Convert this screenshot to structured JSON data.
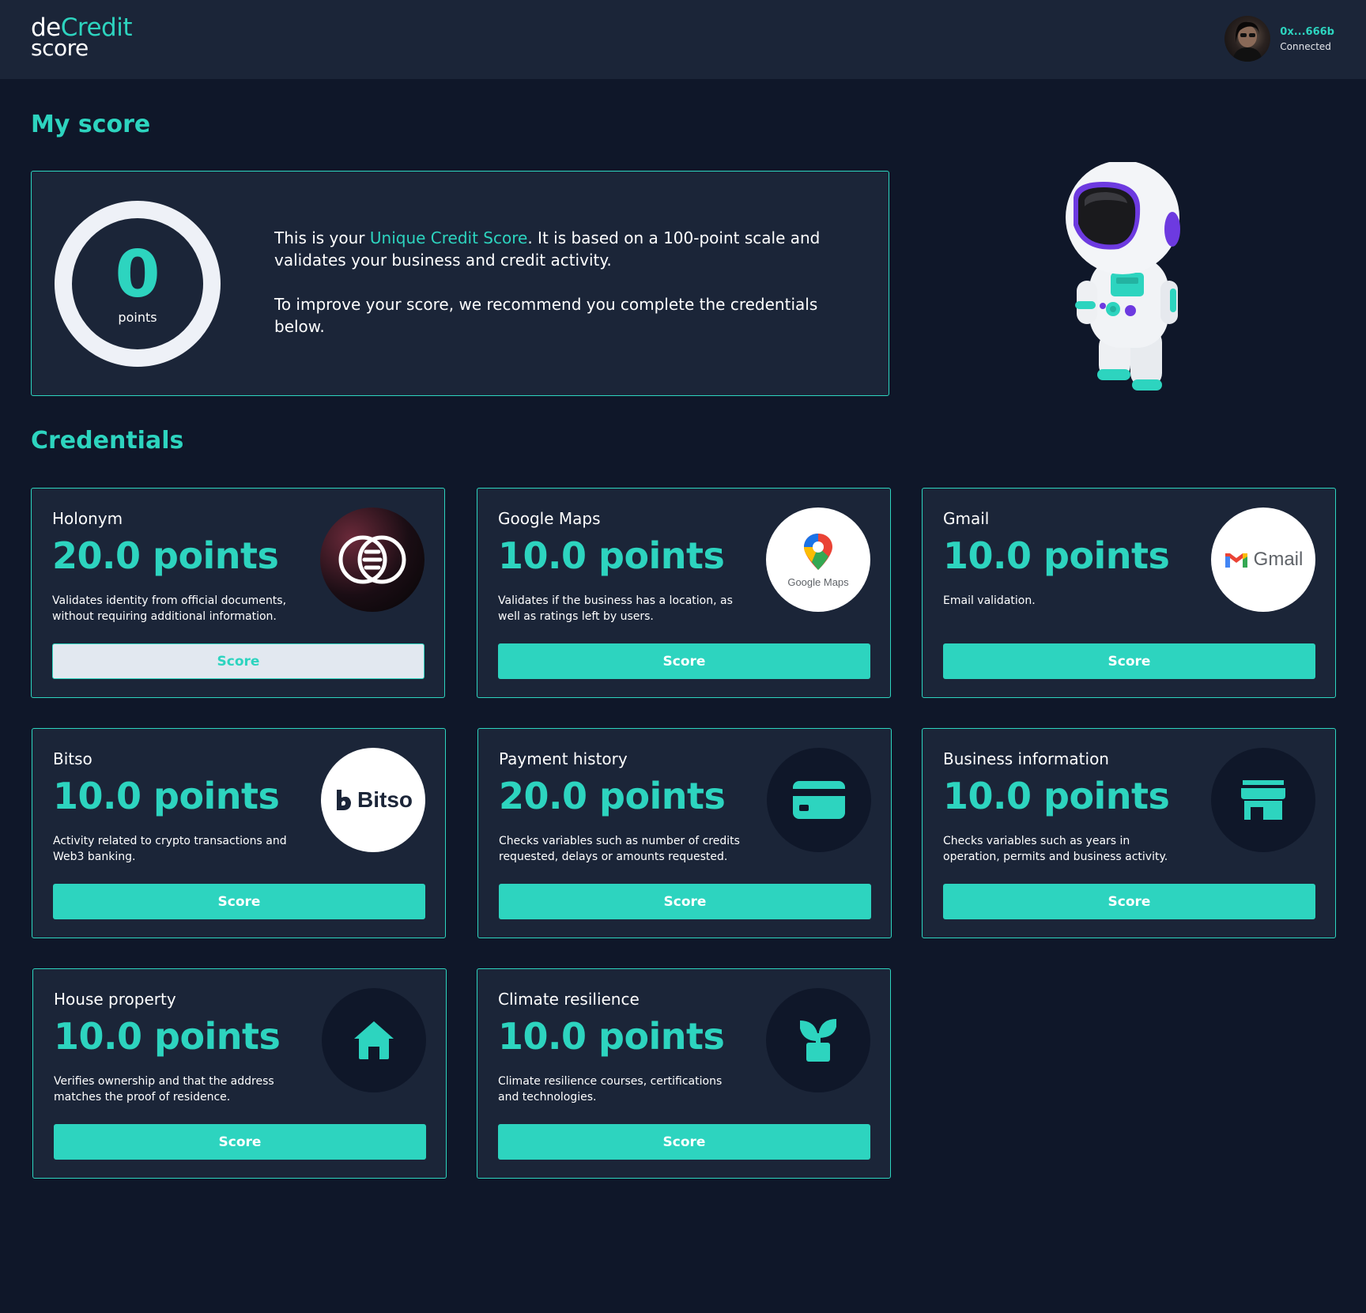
{
  "header": {
    "logo_de": "de",
    "logo_credit": "Credit",
    "logo_score": "score",
    "wallet_address": "0x...666b",
    "wallet_status": "Connected"
  },
  "my_score": {
    "title": "My score",
    "value": "0",
    "unit": "points",
    "text_prefix": "This is your ",
    "text_highlight": "Unique Credit Score",
    "text_suffix": ". It is based on a 100-point scale and validates your business and credit activity.",
    "recommendation": "To improve your score, we recommend you complete the credentials below."
  },
  "credentials": {
    "title": "Credentials",
    "items": [
      {
        "name": "Holonym",
        "points": "20.0 points",
        "description": "Validates identity from official documents, without requiring additional information.",
        "button": "Score",
        "icon": "holonym-logo",
        "button_style": "light"
      },
      {
        "name": "Google Maps",
        "points": "10.0 points",
        "description": "Validates if the business has a location, as well as ratings left by users.",
        "button": "Score",
        "icon": "google-maps-logo",
        "logo_text": "Google Maps"
      },
      {
        "name": "Gmail",
        "points": "10.0 points",
        "description": "Email validation.",
        "button": "Score",
        "icon": "gmail-logo",
        "logo_text": "Gmail"
      },
      {
        "name": "Bitso",
        "points": "10.0 points",
        "description": "Activity related to crypto transactions and Web3 banking.",
        "button": "Score",
        "icon": "bitso-logo",
        "logo_text": "Bitso"
      },
      {
        "name": "Payment history",
        "points": "20.0 points",
        "description": "Checks variables such as number of credits requested, delays or amounts requested.",
        "button": "Score",
        "icon": "credit-card-icon"
      },
      {
        "name": "Business information",
        "points": "10.0 points",
        "description": "Checks variables such as years in operation, permits and business activity.",
        "button": "Score",
        "icon": "store-icon"
      },
      {
        "name": "House property",
        "points": "10.0 points",
        "description": "Verifies ownership and that the address matches the proof of residence.",
        "button": "Score",
        "icon": "home-icon"
      },
      {
        "name": "Climate resilience",
        "points": "10.0 points",
        "description": "Climate resilience courses, certifications and technologies.",
        "button": "Score",
        "icon": "sprout-icon"
      }
    ]
  },
  "colors": {
    "accent": "#2dd4bf",
    "background": "#0f1729",
    "panel": "#1b2538"
  }
}
